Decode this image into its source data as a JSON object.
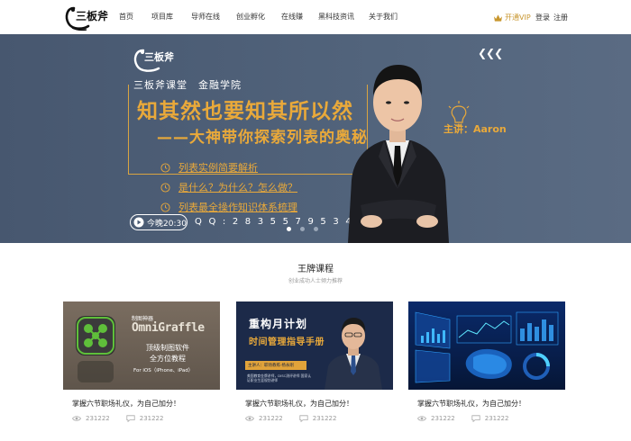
{
  "header": {
    "logo_text": "三板斧",
    "nav": [
      "首页",
      "项目库",
      "导师在线",
      "创业孵化",
      "在线赚",
      "黑科技资讯",
      "关于我们"
    ],
    "vip_label": "开通VIP",
    "login_label": "登录",
    "register_label": "注册"
  },
  "banner": {
    "logo_text": "三板斧",
    "subtitle": "三板斧课堂　金融学院",
    "headline": "知其然也要知其所以然",
    "sub_headline": "——大神带你探索列表的奥秘",
    "bullets": [
      "列表实例简要解析",
      "是什么？为什么？怎么做？",
      "列表最全操作知识体系梳理"
    ],
    "time_label": "今晚20:30",
    "qq_label": "Q Q : 2 8 3 5 5 7 9 5 3 4",
    "speaker_label": "主讲：Aaron",
    "arrows": "❮❮❮"
  },
  "section": {
    "title": "王牌课程",
    "subtitle": "创业成功人士倾力推荐"
  },
  "cards": [
    {
      "title": "掌握六节职场礼仪，为自己加分！",
      "views": "231222",
      "comments": "231222",
      "thumb": {
        "tag": "制图神器",
        "brand": "OmniGraffle",
        "line1": "顶级制图软件",
        "line2": "全方位教程",
        "line3": "For iOS（iPhone、iPad）"
      }
    },
    {
      "title": "掌握六节职场礼仪，为自己加分！",
      "views": "231222",
      "comments": "231222",
      "thumb": {
        "line1": "重构月计划",
        "line2": "时间管理指导手册",
        "caption": "主讲人：职场教练·杨永刚",
        "note": "美国教育金牌讲师，DISC测评讲师 国家认证职业生涯规划讲师"
      }
    },
    {
      "title": "掌握六节职场礼仪，为自己加分！",
      "views": "231222",
      "comments": "231222",
      "thumb": {}
    }
  ],
  "colors": {
    "accent": "#e9a93a",
    "banner_bg": "#4a5b73",
    "vip": "#c8962e"
  }
}
